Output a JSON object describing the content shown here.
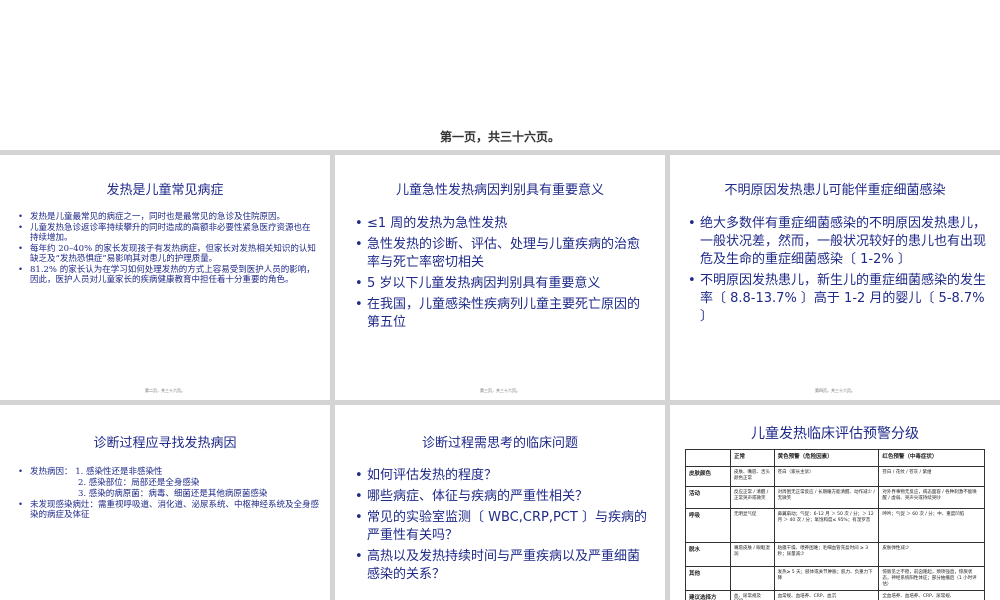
{
  "page_caption": "第一页，共三十六页。",
  "slides": [
    {
      "title": "发热是儿童常见病症",
      "bullets": [
        "发热是儿童最常见的病症之一，同时也是最常见的急诊及住院原因。",
        "儿童发热急诊返诊率持续攀升的同时造成的高额非必要性紧急医疗资源也在持续增加。",
        "每年约 20–40% 的家长发现孩子有发热病症，但家长对发热相关知识的认知缺乏及“发热恐惧症”易影响其对患儿的护理质量。",
        "81.2% 的家长认为在学习如何处理发热的方式上容易受到医护人员的影响，因此，医护人员对儿童家长的疾病健康教育中担任着十分重要的角色。"
      ],
      "footer": "第二页，共三十六页。"
    },
    {
      "title": "儿童急性发热病因判别具有重要意义",
      "bullets": [
        "≤1 周的发热为急性发热",
        "急性发热的诊断、评估、处理与儿童疾病的治愈率与死亡率密切相关",
        "5 岁以下儿童发热病因判别具有重要意义",
        "在我国，儿童感染性疾病列儿童主要死亡原因的第五位"
      ],
      "footer": "第三页，共三十六页。"
    },
    {
      "title": "不明原因发热患儿可能伴重症细菌感染",
      "bullets": [
        "绝大多数伴有重症细菌感染的不明原因发热患儿，一般状况差，然而，一般状况较好的患儿也有出现危及生命的重症细菌感染〔 1-2% 〕",
        "不明原因发热患儿，新生儿的重症细菌感染的发生率〔 8.8-13.7% 〕高于 1-2 月的婴儿〔 5-8.7% 〕"
      ],
      "footer": "第四页，共三十六页。"
    },
    {
      "title": "诊断过程应寻找发热病因",
      "bullets": [
        "发热病因：  1. 感染性还是非感染性",
        "2. 感染部位：局部还是全身感染",
        "3. 感染的病原菌：病毒、细菌还是其他病原菌感染",
        "未发现感染病灶：需重视呼吸道、消化道、泌尿系统、中枢神经系统及全身感染的病症及体征"
      ]
    },
    {
      "title": "诊断过程需思考的临床问题",
      "bullets": [
        "如何评估发热的程度？",
        "哪些病症、体征与疾病的严重性相关？",
        "常见的实验室监测〔 WBC,CRP,PCT 〕与疾病的严重性有关吗？",
        "高热以及发热持续时间与严重疾病以及严重细菌感染的关系？"
      ]
    },
    {
      "title": "儿童发热临床评估预警分级",
      "table": {
        "headers": [
          "",
          "正常",
          "黄色预警（危险因素）",
          "红色预警（中毒症状）"
        ],
        "rows": [
          [
            "皮肤颜色",
            "皮肤、嘴唇、舌头颜色正常",
            "苍白（家长主诉）",
            "苍白 / 花纹 / 苍灰 / 紫绀"
          ],
          [
            "活动",
            "反应正常 / 清醒 / 正常哭声或微笑",
            "对周围无正常反应 / 长期睡方能清醒、动作减少 / 无微笑",
            "对外界事物无反应，病态面容 / 各种刺激不能唤醒 / 虚弱、哭声尖或持续哭吵"
          ],
          [
            "呼吸",
            "无明显气促",
            "鼻翼扇动；气促：6-12 月 ＞ 50 次 / 分；＞ 12 月 ＞ 40 次 / 分；氧饱和度≤ 95%；有湿罗音",
            "呻吟；气促 ＞ 60 次 / 分；中、重度凹陷"
          ],
          [
            "脱水",
            "嘴唇皮肤 / 眼眶湿润",
            "粘膜干燥、喂养困难；毛细血管充盈时间 ≥ 3 秒；尿量减少",
            "皮肤弹性减少"
          ],
          [
            "其他",
            "",
            "发热≥ 5 天；肢体或关节肿胀；肌力、负重力下降",
            "惊厥见之不稳，前囟隆起，颈项强直，惊厥状态，神经系统阳性体征；部分抽搐后（1 小时评估）"
          ],
          [
            "建议选择方",
            "血、尿常规及 CRP",
            "血常规、血培养、CRP、血沉",
            "全血培养、血培养、CRP、尿常规、"
          ]
        ]
      }
    }
  ]
}
